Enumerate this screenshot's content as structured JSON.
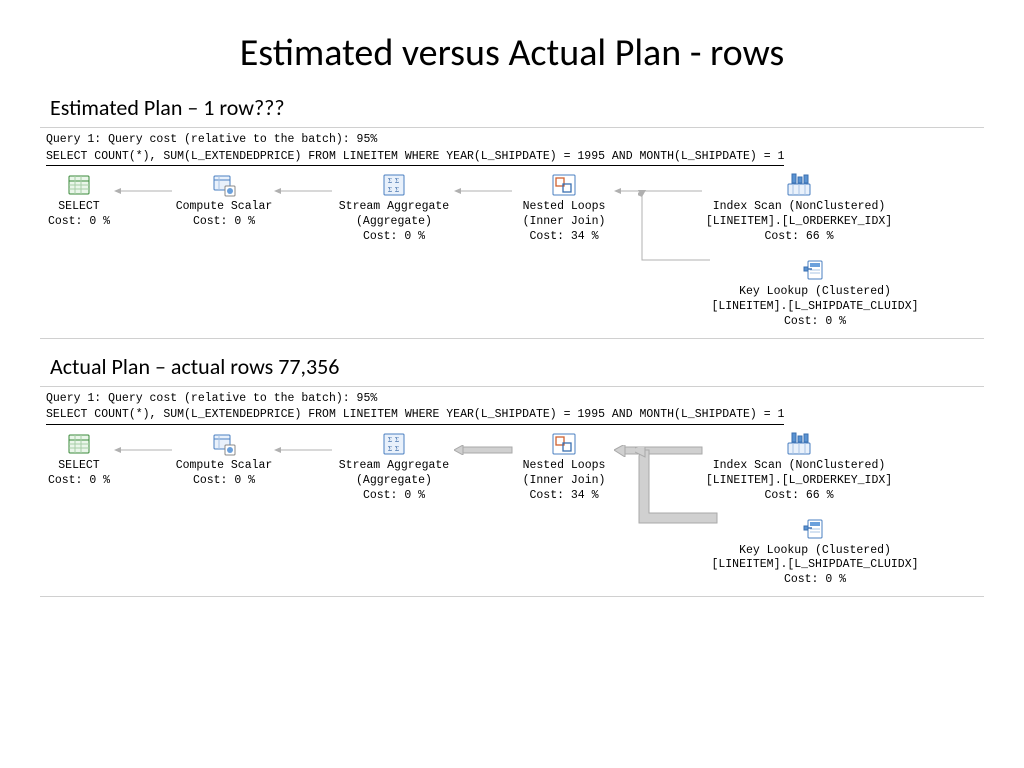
{
  "title": "Estimated versus Actual Plan - rows",
  "section1": {
    "subtitle": "Estimated Plan – 1 row???",
    "query_cost_line": "Query 1: Query cost (relative to the batch): 95%",
    "query_sql": "SELECT COUNT(*), SUM(L_EXTENDEDPRICE) FROM LINEITEM WHERE YEAR(L_SHIPDATE) = 1995 AND MONTH(L_SHIPDATE) = 1",
    "ops": {
      "select": {
        "label": "SELECT",
        "cost": "Cost: 0 %"
      },
      "compute": {
        "label": "Compute Scalar",
        "cost": "Cost: 0 %"
      },
      "stream": {
        "label": "Stream Aggregate",
        "sublabel": "(Aggregate)",
        "cost": "Cost: 0 %"
      },
      "nested": {
        "label": "Nested Loops",
        "sublabel": "(Inner Join)",
        "cost": "Cost: 34 %"
      },
      "indexscan": {
        "label": "Index Scan (NonClustered)",
        "meta": "[LINEITEM].[L_ORDERKEY_IDX]",
        "cost": "Cost: 66 %"
      },
      "keylookup": {
        "label": "Key Lookup (Clustered)",
        "meta": "[LINEITEM].[L_SHIPDATE_CLUIDX]",
        "cost": "Cost: 0 %"
      }
    }
  },
  "section2": {
    "subtitle": "Actual Plan – actual rows 77,356",
    "query_cost_line": "Query 1: Query cost (relative to the batch): 95%",
    "query_sql": "SELECT COUNT(*), SUM(L_EXTENDEDPRICE) FROM LINEITEM WHERE YEAR(L_SHIPDATE) = 1995 AND MONTH(L_SHIPDATE) = 1",
    "ops": {
      "select": {
        "label": "SELECT",
        "cost": "Cost: 0 %"
      },
      "compute": {
        "label": "Compute Scalar",
        "cost": "Cost: 0 %"
      },
      "stream": {
        "label": "Stream Aggregate",
        "sublabel": "(Aggregate)",
        "cost": "Cost: 0 %"
      },
      "nested": {
        "label": "Nested Loops",
        "sublabel": "(Inner Join)",
        "cost": "Cost: 34 %"
      },
      "indexscan": {
        "label": "Index Scan (NonClustered)",
        "meta": "[LINEITEM].[L_ORDERKEY_IDX]",
        "cost": "Cost: 66 %"
      },
      "keylookup": {
        "label": "Key Lookup (Clustered)",
        "meta": "[LINEITEM].[L_SHIPDATE_CLUIDX]",
        "cost": "Cost: 0 %"
      }
    }
  },
  "arrow_thin_color": "#b0b0b0",
  "arrow_thick_color": "#c8c8c8"
}
